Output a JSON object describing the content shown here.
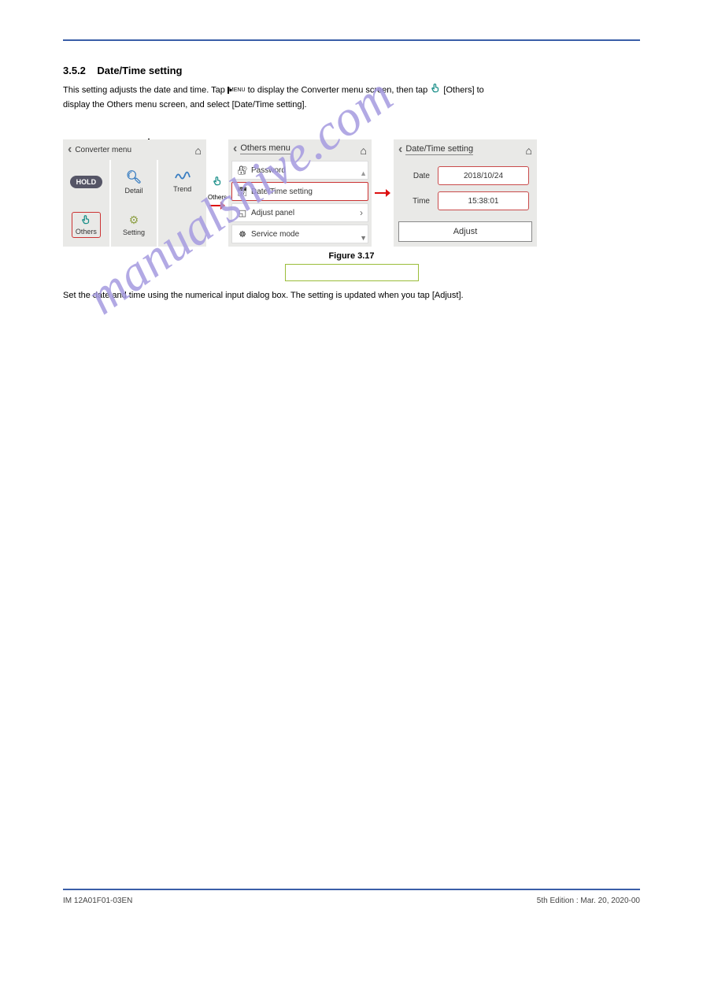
{
  "section": {
    "number": "3.5.2",
    "title": "Date/Time setting"
  },
  "intro": {
    "line1a": "This setting adjusts the date and time. Tap ",
    "line1b": " to display the Converter menu screen, then tap ",
    "line1c": " [Others] to",
    "line2": "display the Others menu screen, and select [Date/Time setting].",
    "others_label": "Others"
  },
  "screen1": {
    "title": "Converter menu",
    "hold": "HOLD",
    "detail": "Detail",
    "trend": "Trend",
    "others": "Others",
    "setting": "Setting"
  },
  "screen2": {
    "title": "Others menu",
    "password": "Password",
    "datetime": "Date/Time setting",
    "adjust_panel": "Adjust panel",
    "service_mode": "Service mode"
  },
  "screen3": {
    "title": "Date/Time setting",
    "date_label": "Date",
    "date_value": "2018/10/24",
    "time_label": "Time",
    "time_value": "15:38:01",
    "adjust": "Adjust"
  },
  "caption": "Figure 3.17",
  "note": "Set the date and time using the numerical input dialog box. The setting is updated when you tap [Adjust].",
  "watermark": "manualshive.com",
  "footer": {
    "doc": "IM 12A01F01-03EN",
    "edition": "5th Edition : Mar. 20, 2020-00"
  }
}
